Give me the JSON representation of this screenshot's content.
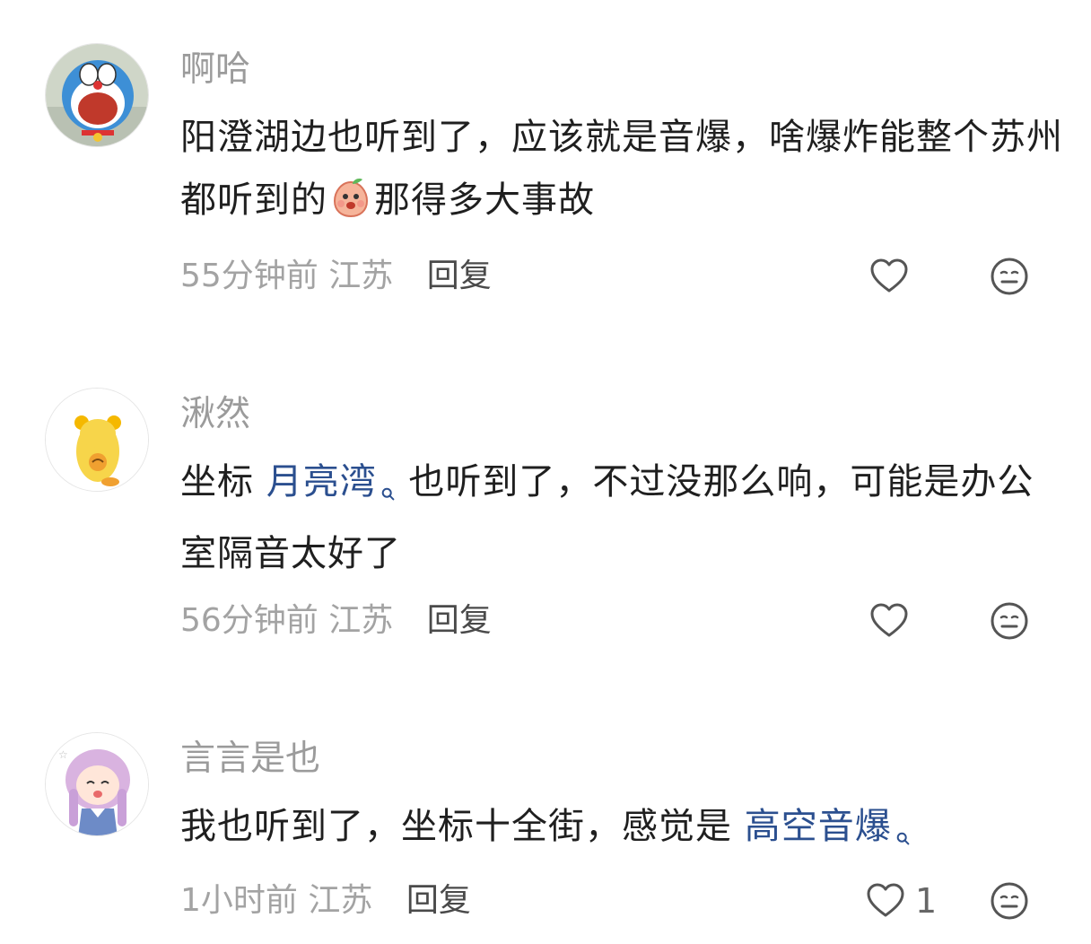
{
  "comments": [
    {
      "username": "啊哈",
      "text_part1": "阳澄湖边也听到了，应该就是音爆，啥爆炸能整个苏州都听到的",
      "emoji": "peach-blush-emoji",
      "text_part2": "那得多大事故",
      "time": "55分钟前",
      "location": "江苏",
      "reply_label": "回复",
      "avatar": "doraemon-avatar"
    },
    {
      "username": "湫然",
      "text_before_link": "坐标 ",
      "link_text": "月亮湾",
      "text_after_link": " 也听到了，不过没那么响，可能是办公室隔音太好了",
      "time": "56分钟前",
      "location": "江苏",
      "reply_label": "回复",
      "avatar": "yellow-duck-avatar"
    },
    {
      "username": "言言是也",
      "text_before_link": "我也听到了，坐标十全街，感觉是 ",
      "link_text": "高空音爆",
      "time": "1小时前",
      "location": "江苏",
      "reply_label": "回复",
      "like_count": "1",
      "avatar": "anime-girl-avatar"
    }
  ],
  "colors": {
    "link": "#2b4f8f",
    "meta": "#a3a3a3",
    "text": "#1f1f1f"
  },
  "icons": [
    "heart-outline-icon",
    "neutral-face-icon",
    "search-icon"
  ]
}
